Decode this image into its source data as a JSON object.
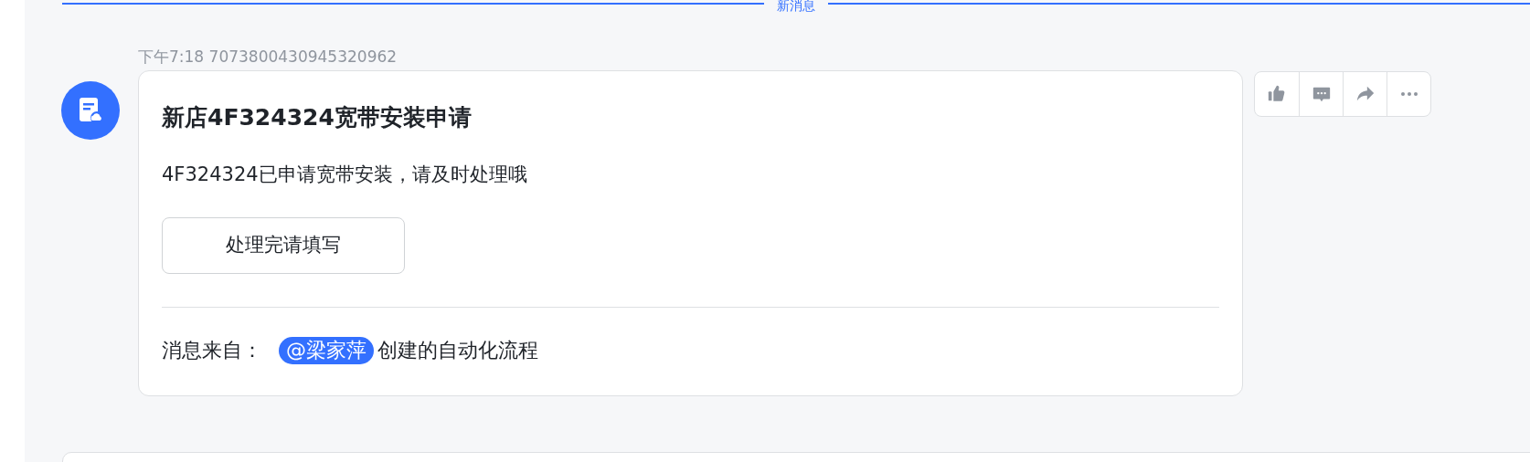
{
  "divider": {
    "label": "新消息"
  },
  "message": {
    "time": "下午7:18",
    "id": "7073800430945320962",
    "card": {
      "title": "新店4F324324宽带安装申请",
      "body": "4F324324已申请宽带安装，请及时处理哦",
      "button": "处理完请填写",
      "footer": {
        "prefix": "消息来自：",
        "mention": "@梁家萍",
        "suffix": "创建的自动化流程"
      }
    },
    "actions": [
      {
        "kind": "like"
      },
      {
        "kind": "reply"
      },
      {
        "kind": "forward"
      },
      {
        "kind": "more"
      }
    ]
  }
}
